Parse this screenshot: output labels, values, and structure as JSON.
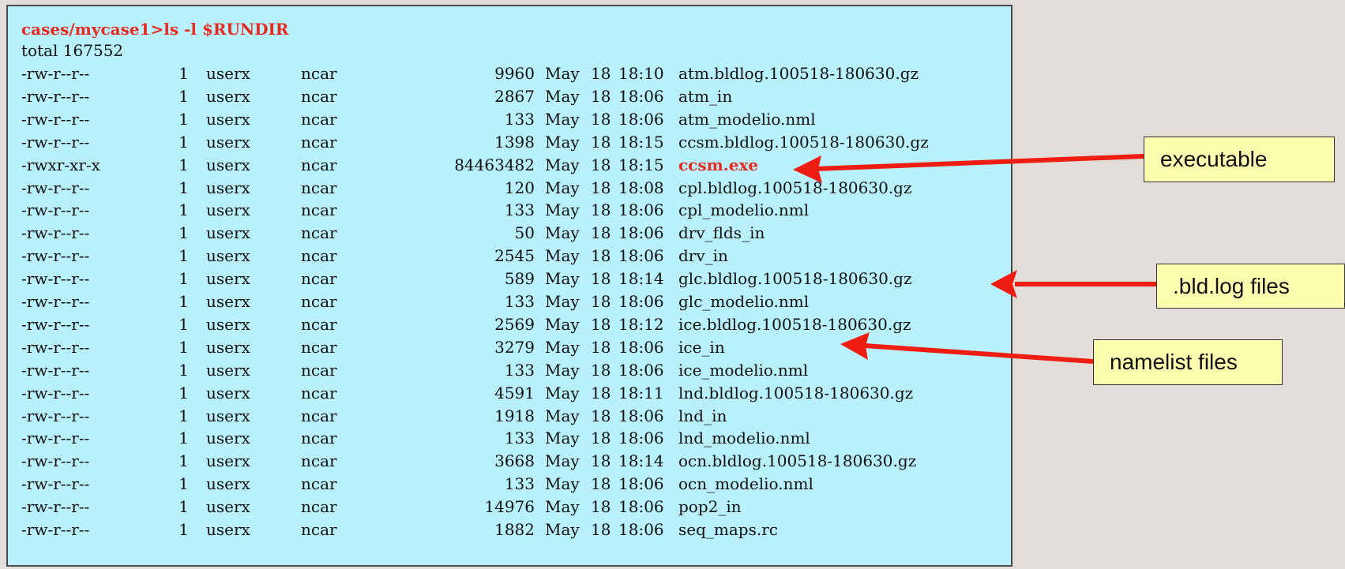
{
  "terminal": {
    "command": "cases/mycase1>ls -l $RUNDIR",
    "total": "total 167552",
    "rows": [
      {
        "perm": "-rw-r--r--",
        "links": "1",
        "owner": "userx",
        "group": "ncar",
        "size": "9960",
        "month": "May",
        "day": "18",
        "time": "18:10",
        "name": "atm.bldlog.100518-180630.gz"
      },
      {
        "perm": "-rw-r--r--",
        "links": "1",
        "owner": "userx",
        "group": "ncar",
        "size": "2867",
        "month": "May",
        "day": "18",
        "time": "18:06",
        "name": "atm_in"
      },
      {
        "perm": "-rw-r--r--",
        "links": "1",
        "owner": "userx",
        "group": "ncar",
        "size": "133",
        "month": "May",
        "day": "18",
        "time": "18:06",
        "name": "atm_modelio.nml"
      },
      {
        "perm": "-rw-r--r--",
        "links": "1",
        "owner": "userx",
        "group": "ncar",
        "size": "1398",
        "month": "May",
        "day": "18",
        "time": "18:15",
        "name": "ccsm.bldlog.100518-180630.gz"
      },
      {
        "perm": "-rwxr-xr-x",
        "links": "1",
        "owner": "userx",
        "group": "ncar",
        "size": "84463482",
        "month": "May",
        "day": "18",
        "time": "18:15",
        "name": "ccsm.exe"
      },
      {
        "perm": "-rw-r--r--",
        "links": "1",
        "owner": "userx",
        "group": "ncar",
        "size": "120",
        "month": "May",
        "day": "18",
        "time": "18:08",
        "name": "cpl.bldlog.100518-180630.gz"
      },
      {
        "perm": "-rw-r--r--",
        "links": "1",
        "owner": "userx",
        "group": "ncar",
        "size": "133",
        "month": "May",
        "day": "18",
        "time": "18:06",
        "name": "cpl_modelio.nml"
      },
      {
        "perm": "-rw-r--r--",
        "links": "1",
        "owner": "userx",
        "group": "ncar",
        "size": "50",
        "month": "May",
        "day": "18",
        "time": "18:06",
        "name": "drv_flds_in"
      },
      {
        "perm": "-rw-r--r--",
        "links": "1",
        "owner": "userx",
        "group": "ncar",
        "size": "2545",
        "month": "May",
        "day": "18",
        "time": "18:06",
        "name": "drv_in"
      },
      {
        "perm": "-rw-r--r--",
        "links": "1",
        "owner": "userx",
        "group": "ncar",
        "size": "589",
        "month": "May",
        "day": "18",
        "time": "18:14",
        "name": "glc.bldlog.100518-180630.gz"
      },
      {
        "perm": "-rw-r--r--",
        "links": "1",
        "owner": "userx",
        "group": "ncar",
        "size": "133",
        "month": "May",
        "day": "18",
        "time": "18:06",
        "name": "glc_modelio.nml"
      },
      {
        "perm": "-rw-r--r--",
        "links": "1",
        "owner": "userx",
        "group": "ncar",
        "size": "2569",
        "month": "May",
        "day": "18",
        "time": "18:12",
        "name": "ice.bldlog.100518-180630.gz"
      },
      {
        "perm": "-rw-r--r--",
        "links": "1",
        "owner": "userx",
        "group": "ncar",
        "size": "3279",
        "month": "May",
        "day": "18",
        "time": "18:06",
        "name": "ice_in"
      },
      {
        "perm": "-rw-r--r--",
        "links": "1",
        "owner": "userx",
        "group": "ncar",
        "size": "133",
        "month": "May",
        "day": "18",
        "time": "18:06",
        "name": "ice_modelio.nml"
      },
      {
        "perm": "-rw-r--r--",
        "links": "1",
        "owner": "userx",
        "group": "ncar",
        "size": "4591",
        "month": "May",
        "day": "18",
        "time": "18:11",
        "name": "lnd.bldlog.100518-180630.gz"
      },
      {
        "perm": "-rw-r--r--",
        "links": "1",
        "owner": "userx",
        "group": "ncar",
        "size": "1918",
        "month": "May",
        "day": "18",
        "time": "18:06",
        "name": "lnd_in"
      },
      {
        "perm": "-rw-r--r--",
        "links": "1",
        "owner": "userx",
        "group": "ncar",
        "size": "133",
        "month": "May",
        "day": "18",
        "time": "18:06",
        "name": "lnd_modelio.nml"
      },
      {
        "perm": "-rw-r--r--",
        "links": "1",
        "owner": "userx",
        "group": "ncar",
        "size": "3668",
        "month": "May",
        "day": "18",
        "time": "18:14",
        "name": "ocn.bldlog.100518-180630.gz"
      },
      {
        "perm": "-rw-r--r--",
        "links": "1",
        "owner": "userx",
        "group": "ncar",
        "size": "133",
        "month": "May",
        "day": "18",
        "time": "18:06",
        "name": "ocn_modelio.nml"
      },
      {
        "perm": "-rw-r--r--",
        "links": "1",
        "owner": "userx",
        "group": "ncar",
        "size": "14976",
        "month": "May",
        "day": "18",
        "time": "18:06",
        "name": "pop2_in"
      },
      {
        "perm": "-rw-r--r--",
        "links": "1",
        "owner": "userx",
        "group": "ncar",
        "size": "1882",
        "month": "May",
        "day": "18",
        "time": "18:06",
        "name": "seq_maps.rc"
      }
    ]
  },
  "callouts": {
    "executable": "executable",
    "bldlog": ".bld.log files",
    "namelist": "namelist files"
  },
  "colors": {
    "terminal_bg": "#b8f0fb",
    "highlight": "#e52a1f",
    "callout_bg": "#fdfdb0",
    "arrow": "#f01e12",
    "page_bg": "#e2ddd9"
  }
}
